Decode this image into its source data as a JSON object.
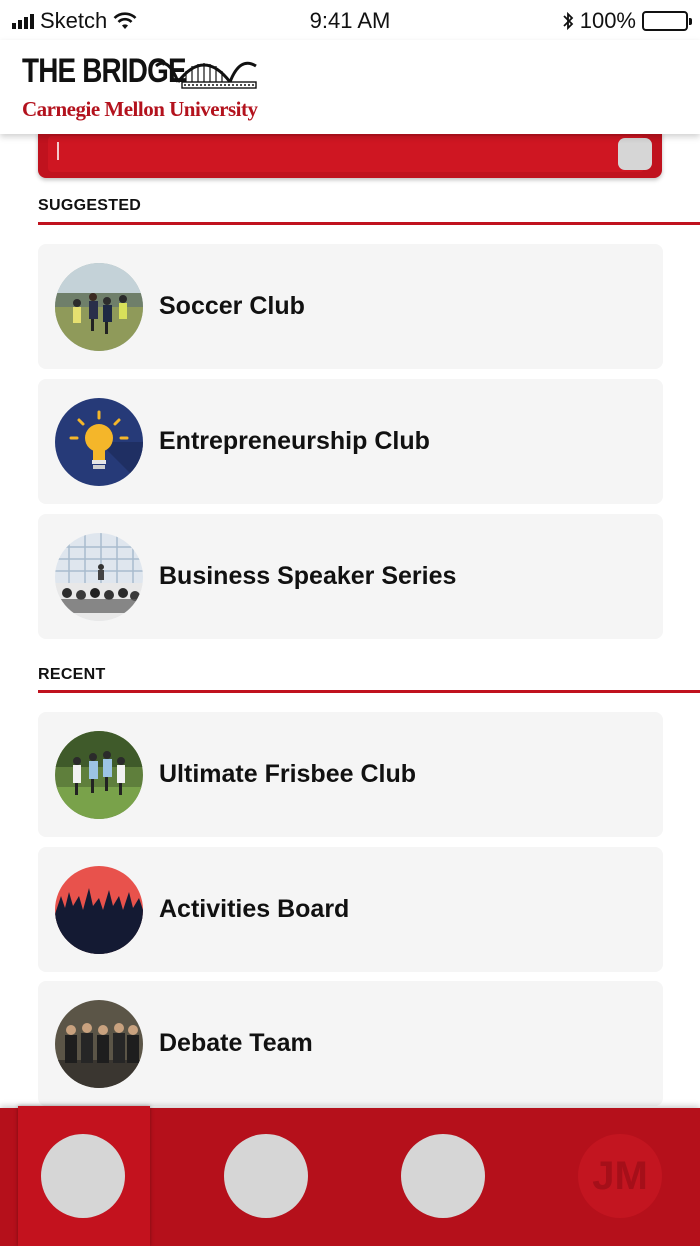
{
  "status_bar": {
    "carrier": "Sketch",
    "time": "9:41 AM",
    "battery": "100%",
    "battery_level": 1.0
  },
  "header": {
    "logo_title": "THE BRIDGE",
    "logo_subtitle": "Carnegie Mellon University",
    "brand_color": "#b3121d"
  },
  "search": {
    "value": "",
    "placeholder": ""
  },
  "sections": {
    "suggested": {
      "heading": "SUGGESTED",
      "items": [
        {
          "label": "Soccer Club",
          "icon": "soccer-photo"
        },
        {
          "label": "Entrepreneurship Club",
          "icon": "lightbulb-icon"
        },
        {
          "label": "Business Speaker Series",
          "icon": "audience-photo"
        }
      ]
    },
    "recent": {
      "heading": "RECENT",
      "items": [
        {
          "label": "Ultimate Frisbee Club",
          "icon": "frisbee-photo"
        },
        {
          "label": "Activities Board",
          "icon": "crowd-silhouette-icon"
        },
        {
          "label": "Debate Team",
          "icon": "team-photo"
        }
      ]
    }
  },
  "bottom_nav": {
    "avatar_initials": "JM",
    "accent": "#b5101b"
  }
}
